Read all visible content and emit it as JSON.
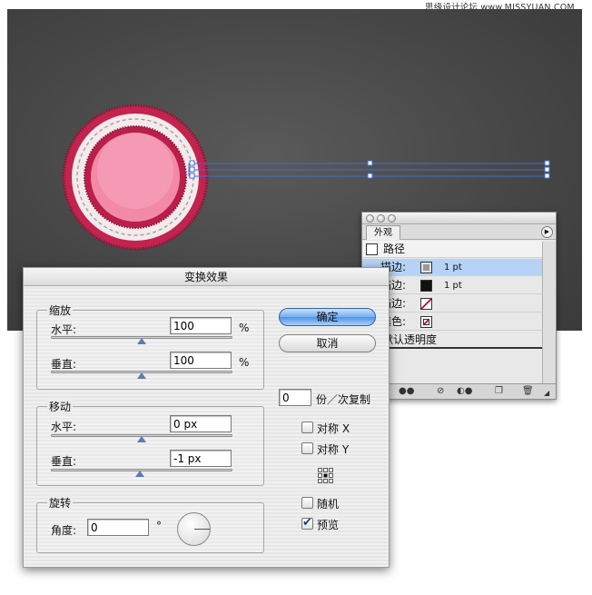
{
  "watermark": "思缘设计论坛 www.MISSYUAN.COM",
  "appearance_panel": {
    "tab": "外观",
    "object_label": "路径",
    "rows": [
      {
        "label": "描边:",
        "value": "1 pt",
        "swatch": "gray",
        "selected": true
      },
      {
        "label": "描边:",
        "value": "1 pt",
        "swatch": "black",
        "selected": false
      },
      {
        "label": "描边:",
        "value": "",
        "swatch": "none",
        "selected": false
      },
      {
        "label": "填色:",
        "value": "",
        "swatch": "none",
        "selected": false
      }
    ],
    "opacity_label": "默认透明度"
  },
  "dialog": {
    "title": "变换效果",
    "scale": {
      "title": "缩放",
      "horizontal_label": "水平:",
      "horizontal_value": "100",
      "vertical_label": "垂直:",
      "vertical_value": "100",
      "unit": "%"
    },
    "move": {
      "title": "移动",
      "horizontal_label": "水平:",
      "horizontal_value": "0 px",
      "vertical_label": "垂直:",
      "vertical_value": "-1 px"
    },
    "rotate": {
      "title": "旋转",
      "angle_label": "角度:",
      "angle_value": "0",
      "degree_symbol": "°"
    },
    "ok_label": "确定",
    "cancel_label": "取消",
    "copies_value": "0",
    "copies_label": "份／次复制",
    "reflect_x_label": "对称 X",
    "reflect_x_checked": false,
    "reflect_y_label": "对称 Y",
    "reflect_y_checked": false,
    "random_label": "随机",
    "random_checked": false,
    "preview_label": "预览",
    "preview_checked": true
  },
  "colors": {
    "canvas": "#474747",
    "badge_outer": "#c2234f",
    "badge_ring": "#f3eaec",
    "badge_inner": "#f28aa7",
    "selection": "#3f6fd8",
    "primary_button": "#5d9be9"
  }
}
